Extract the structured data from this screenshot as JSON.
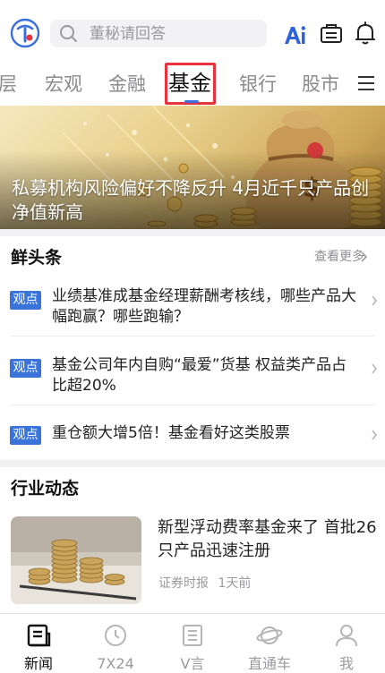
{
  "header": {
    "search_placeholder": "董秘请回答",
    "icons": [
      "app-logo-icon",
      "search-icon",
      "ai-icon",
      "briefcase-icon",
      "bell-icon"
    ]
  },
  "tabs": [
    {
      "label": "层",
      "active": false
    },
    {
      "label": "宏观",
      "active": false
    },
    {
      "label": "金融",
      "active": false
    },
    {
      "label": "基金",
      "active": true
    },
    {
      "label": "银行",
      "active": false
    },
    {
      "label": "股市",
      "active": false
    }
  ],
  "banner": {
    "title": "私募机构风险偏好不降反升 4月近千只产品创净值新高"
  },
  "headlines": {
    "title": "鲜头条",
    "more_label": "查看更多",
    "items": [
      {
        "badge": "观点",
        "text": "业绩基准成基金经理薪酬考核线，哪些产品大幅跑赢？哪些跑输？"
      },
      {
        "badge": "观点",
        "text": "基金公司年内自购“最爱”货基 权益类产品占比超20%"
      },
      {
        "badge": "观点",
        "text": "重仓额大增5倍！基金看好这类股票"
      }
    ]
  },
  "industry": {
    "title": "行业动态",
    "articles": [
      {
        "title": "新型浮动费率基金来了 首批26只产品迅速注册",
        "source": "证券时报",
        "time": "1天前"
      }
    ]
  },
  "bottom_nav": [
    {
      "label": "新闻",
      "active": true,
      "icon": "news-icon"
    },
    {
      "label": "7X24",
      "active": false,
      "icon": "clock-icon"
    },
    {
      "label": "V言",
      "active": false,
      "icon": "document-icon"
    },
    {
      "label": "直通车",
      "active": false,
      "icon": "planet-icon"
    },
    {
      "label": "我",
      "active": false,
      "icon": "person-icon"
    }
  ],
  "colors": {
    "accent_blue": "#3a73d9",
    "highlight_red": "#e8333f",
    "gold": "#d4a94a"
  }
}
